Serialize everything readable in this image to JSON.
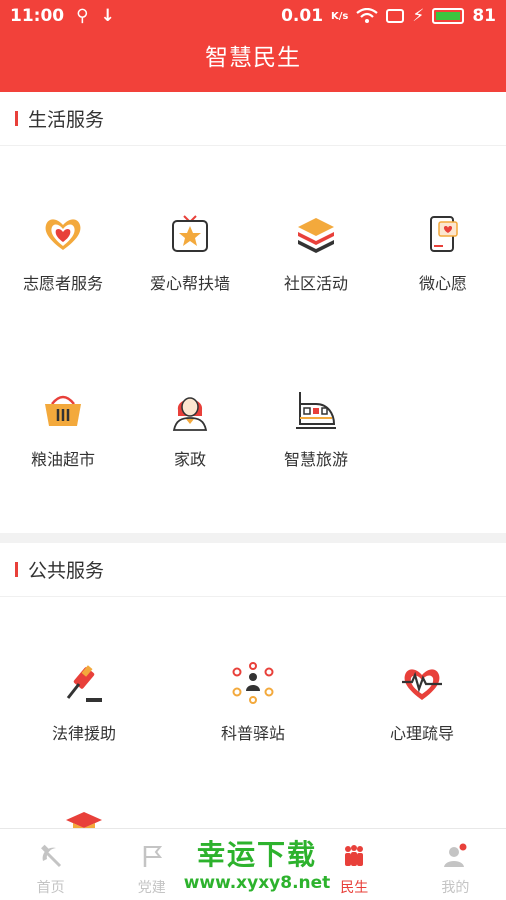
{
  "status_bar": {
    "time": "11:00",
    "speed": "0.01",
    "speed_unit": "K/s",
    "battery": "81"
  },
  "header": {
    "title": "智慧民生"
  },
  "sections": [
    {
      "title": "生活服务",
      "items": [
        {
          "label": "志愿者服务",
          "icon": "heart-hands-icon"
        },
        {
          "label": "爱心帮扶墙",
          "icon": "tv-star-icon"
        },
        {
          "label": "社区活动",
          "icon": "layers-icon"
        },
        {
          "label": "微心愿",
          "icon": "phone-heart-icon"
        },
        {
          "label": "粮油超市",
          "icon": "basket-icon"
        },
        {
          "label": "家政",
          "icon": "housekeeper-icon"
        },
        {
          "label": "智慧旅游",
          "icon": "train-icon"
        }
      ]
    },
    {
      "title": "公共服务",
      "items": [
        {
          "label": "法律援助",
          "icon": "gavel-icon"
        },
        {
          "label": "科普驿站",
          "icon": "network-icon"
        },
        {
          "label": "心理疏导",
          "icon": "heart-pulse-icon"
        },
        {
          "label": "",
          "icon": "graduation-cap-icon"
        }
      ]
    }
  ],
  "bottom_nav": [
    {
      "label": "首页",
      "icon": "hammer-sickle-icon",
      "active": false
    },
    {
      "label": "党建",
      "icon": "flag-icon",
      "active": false
    },
    {
      "label": "",
      "icon": "hidden-icon",
      "active": false
    },
    {
      "label": "民生",
      "icon": "people-icon",
      "active": true
    },
    {
      "label": "我的",
      "icon": "user-icon",
      "active": false
    }
  ],
  "watermark": {
    "line1": "幸运下载",
    "line2": "www.xyxy8.net"
  },
  "colors": {
    "primary": "#f2413a",
    "accent": "#e8403a",
    "watermark": "#2db22d"
  }
}
